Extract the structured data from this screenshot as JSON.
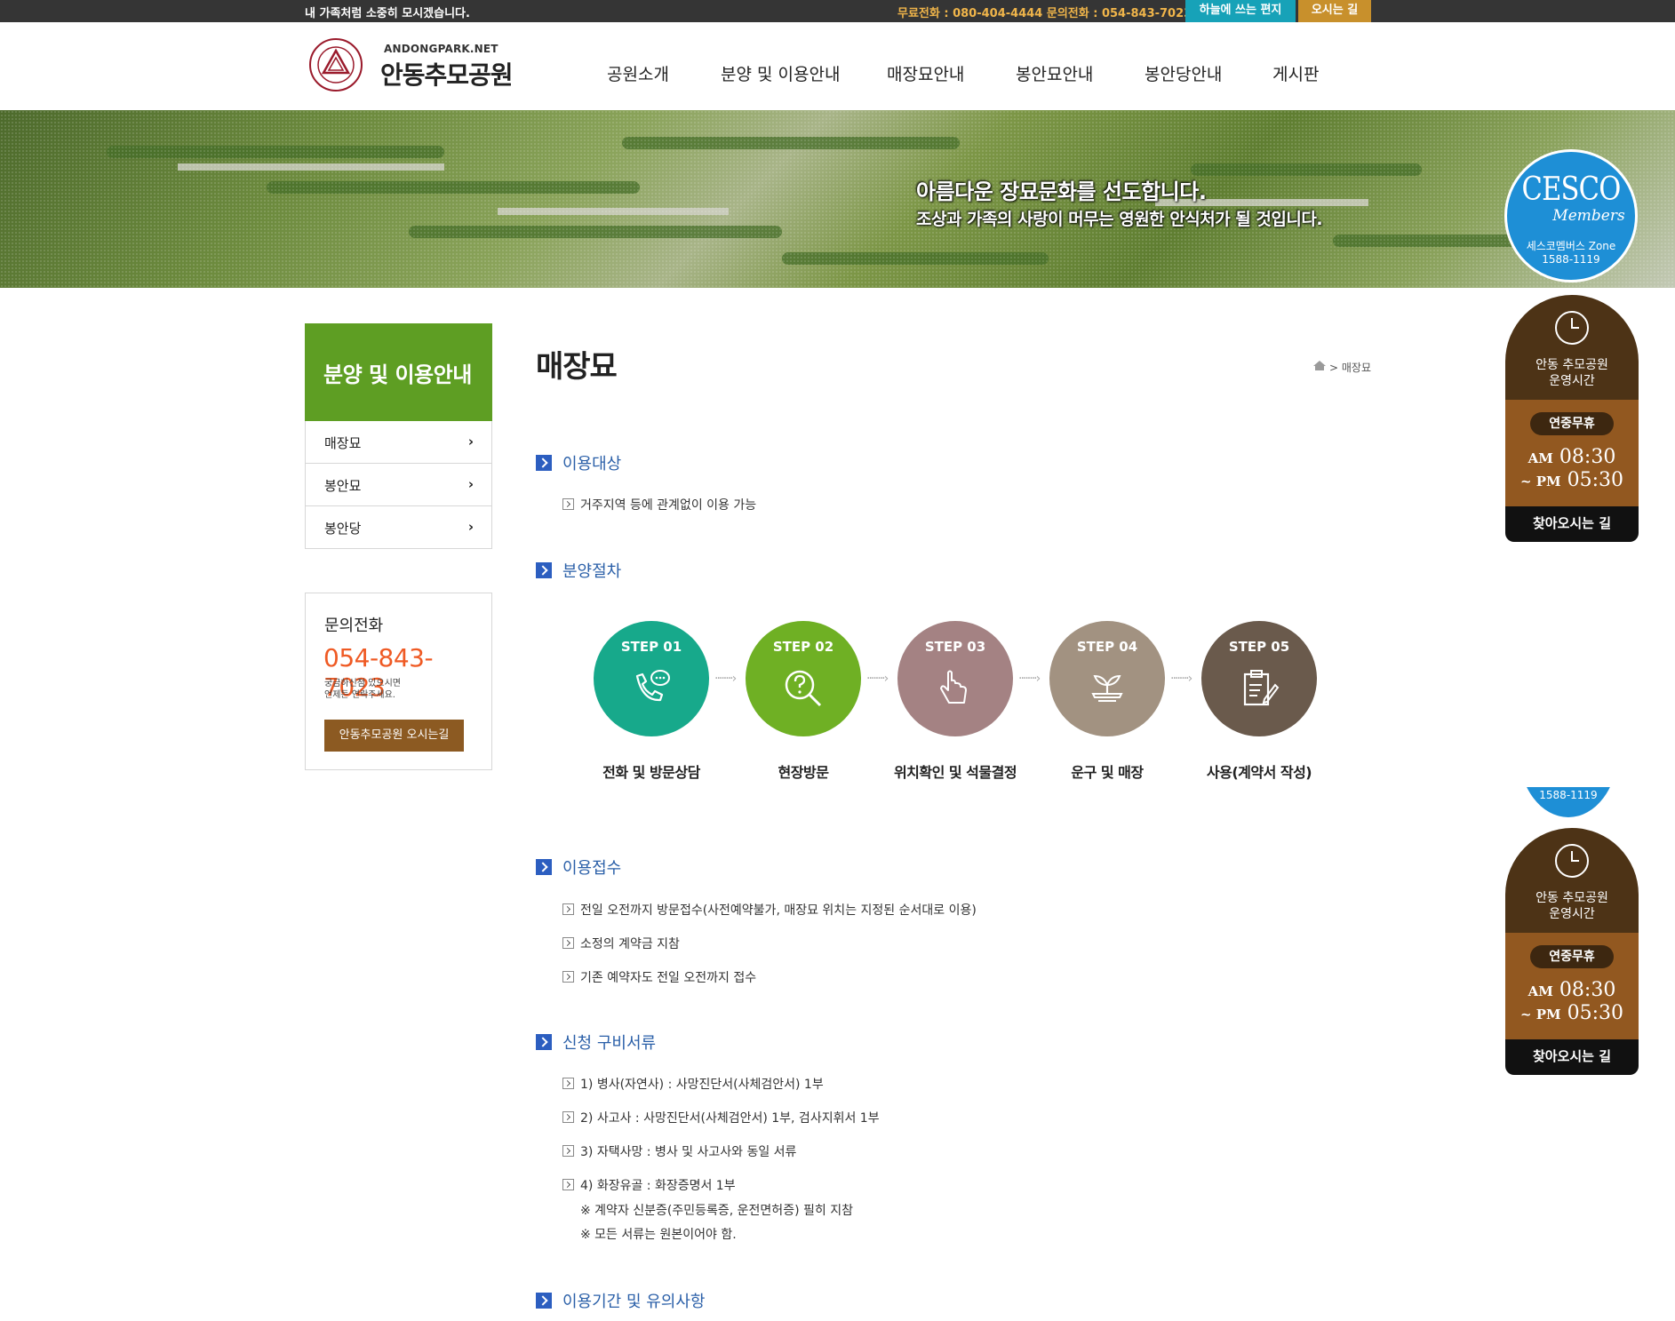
{
  "topbar": {
    "slogan": "내 가족처럼 소중히 모시겠습니다.",
    "phones": "무료전화 : 080-404-4444 문의전화 : 054-843-7023",
    "letter_btn": "하늘에 쓰는 편지",
    "way_btn": "오시는 길"
  },
  "header": {
    "logo_small": "ANDONGPARK.NET",
    "logo_big": "안동추모공원",
    "nav": [
      "공원소개",
      "분양 및 이용안내",
      "매장묘안내",
      "봉안묘안내",
      "봉안당안내",
      "게시판"
    ]
  },
  "banner": {
    "line1": "아름다운 장묘문화를 선도합니다.",
    "line2": "조상과 가족의 사랑이 머무는 영원한 안식처가 될 것입니다."
  },
  "cesco": {
    "brand": "CESCO",
    "sub": "Members",
    "zone": "세스코멤버스 Zone",
    "phone": "1588-1119"
  },
  "hours": {
    "title1": "안동 추모공원",
    "title2": "운영시간",
    "title1_b": "안동 추모공원",
    "title2_b": "운영시간",
    "pill": "연중무휴",
    "am_label": "AM",
    "am_time": "08:30",
    "pm_label": "~ PM",
    "pm_time": "05:30",
    "link": "찾아오시는 길"
  },
  "sidebar": {
    "title": "분양 및 이용안내",
    "items": [
      "매장묘",
      "봉안묘",
      "봉안당"
    ],
    "contact_title": "문의전화",
    "contact_phone": "054-843-7023",
    "contact_desc1": "궁금하신점 있으시면",
    "contact_desc2": "언제든 연락주세요.",
    "contact_btn": "안동추모공원 오시는길"
  },
  "content": {
    "title": "매장묘",
    "breadcrumb": "매장묘",
    "sec1": "이용대상",
    "sec1_items": [
      "거주지역 등에 관계없이 이용 가능"
    ],
    "sec2": "분양절차",
    "steps": [
      {
        "label": "STEP 01",
        "name": "전화 및 방문상담",
        "color": "#17a98b"
      },
      {
        "label": "STEP 02",
        "name": "현장방문",
        "color": "#6fb024"
      },
      {
        "label": "STEP 03",
        "name": "위치확인 및 석물결정",
        "color": "#a48283"
      },
      {
        "label": "STEP 04",
        "name": "운구 및 매장",
        "color": "#a29281"
      },
      {
        "label": "STEP 05",
        "name": "사용(계약서 작성)",
        "color": "#6a5a4c"
      }
    ],
    "sec3": "이용접수",
    "sec3_items": [
      "전일 오전까지 방문접수(사전예약불가, 매장묘 위치는 지정된 순서대로 이용)",
      "소정의 계약금 지참",
      "기존 예약자도 전일 오전까지 접수"
    ],
    "sec4": "신청 구비서류",
    "sec4_items": [
      "1) 병사(자연사) : 사망진단서(사체검안서) 1부",
      "2) 사고사 : 사망진단서(사체검안서) 1부, 검사지휘서 1부",
      "3) 자택사망 : 병사 및 사고사와 동일 서류",
      "4) 화장유골 : 화장증명서 1부"
    ],
    "sec4_notes": [
      "※ 계약자 신분증(주민등록증, 운전면허증) 필히 지참",
      "※ 모든 서류는 원본이어야 함."
    ],
    "sec5": "이용기간 및 유의사항"
  }
}
